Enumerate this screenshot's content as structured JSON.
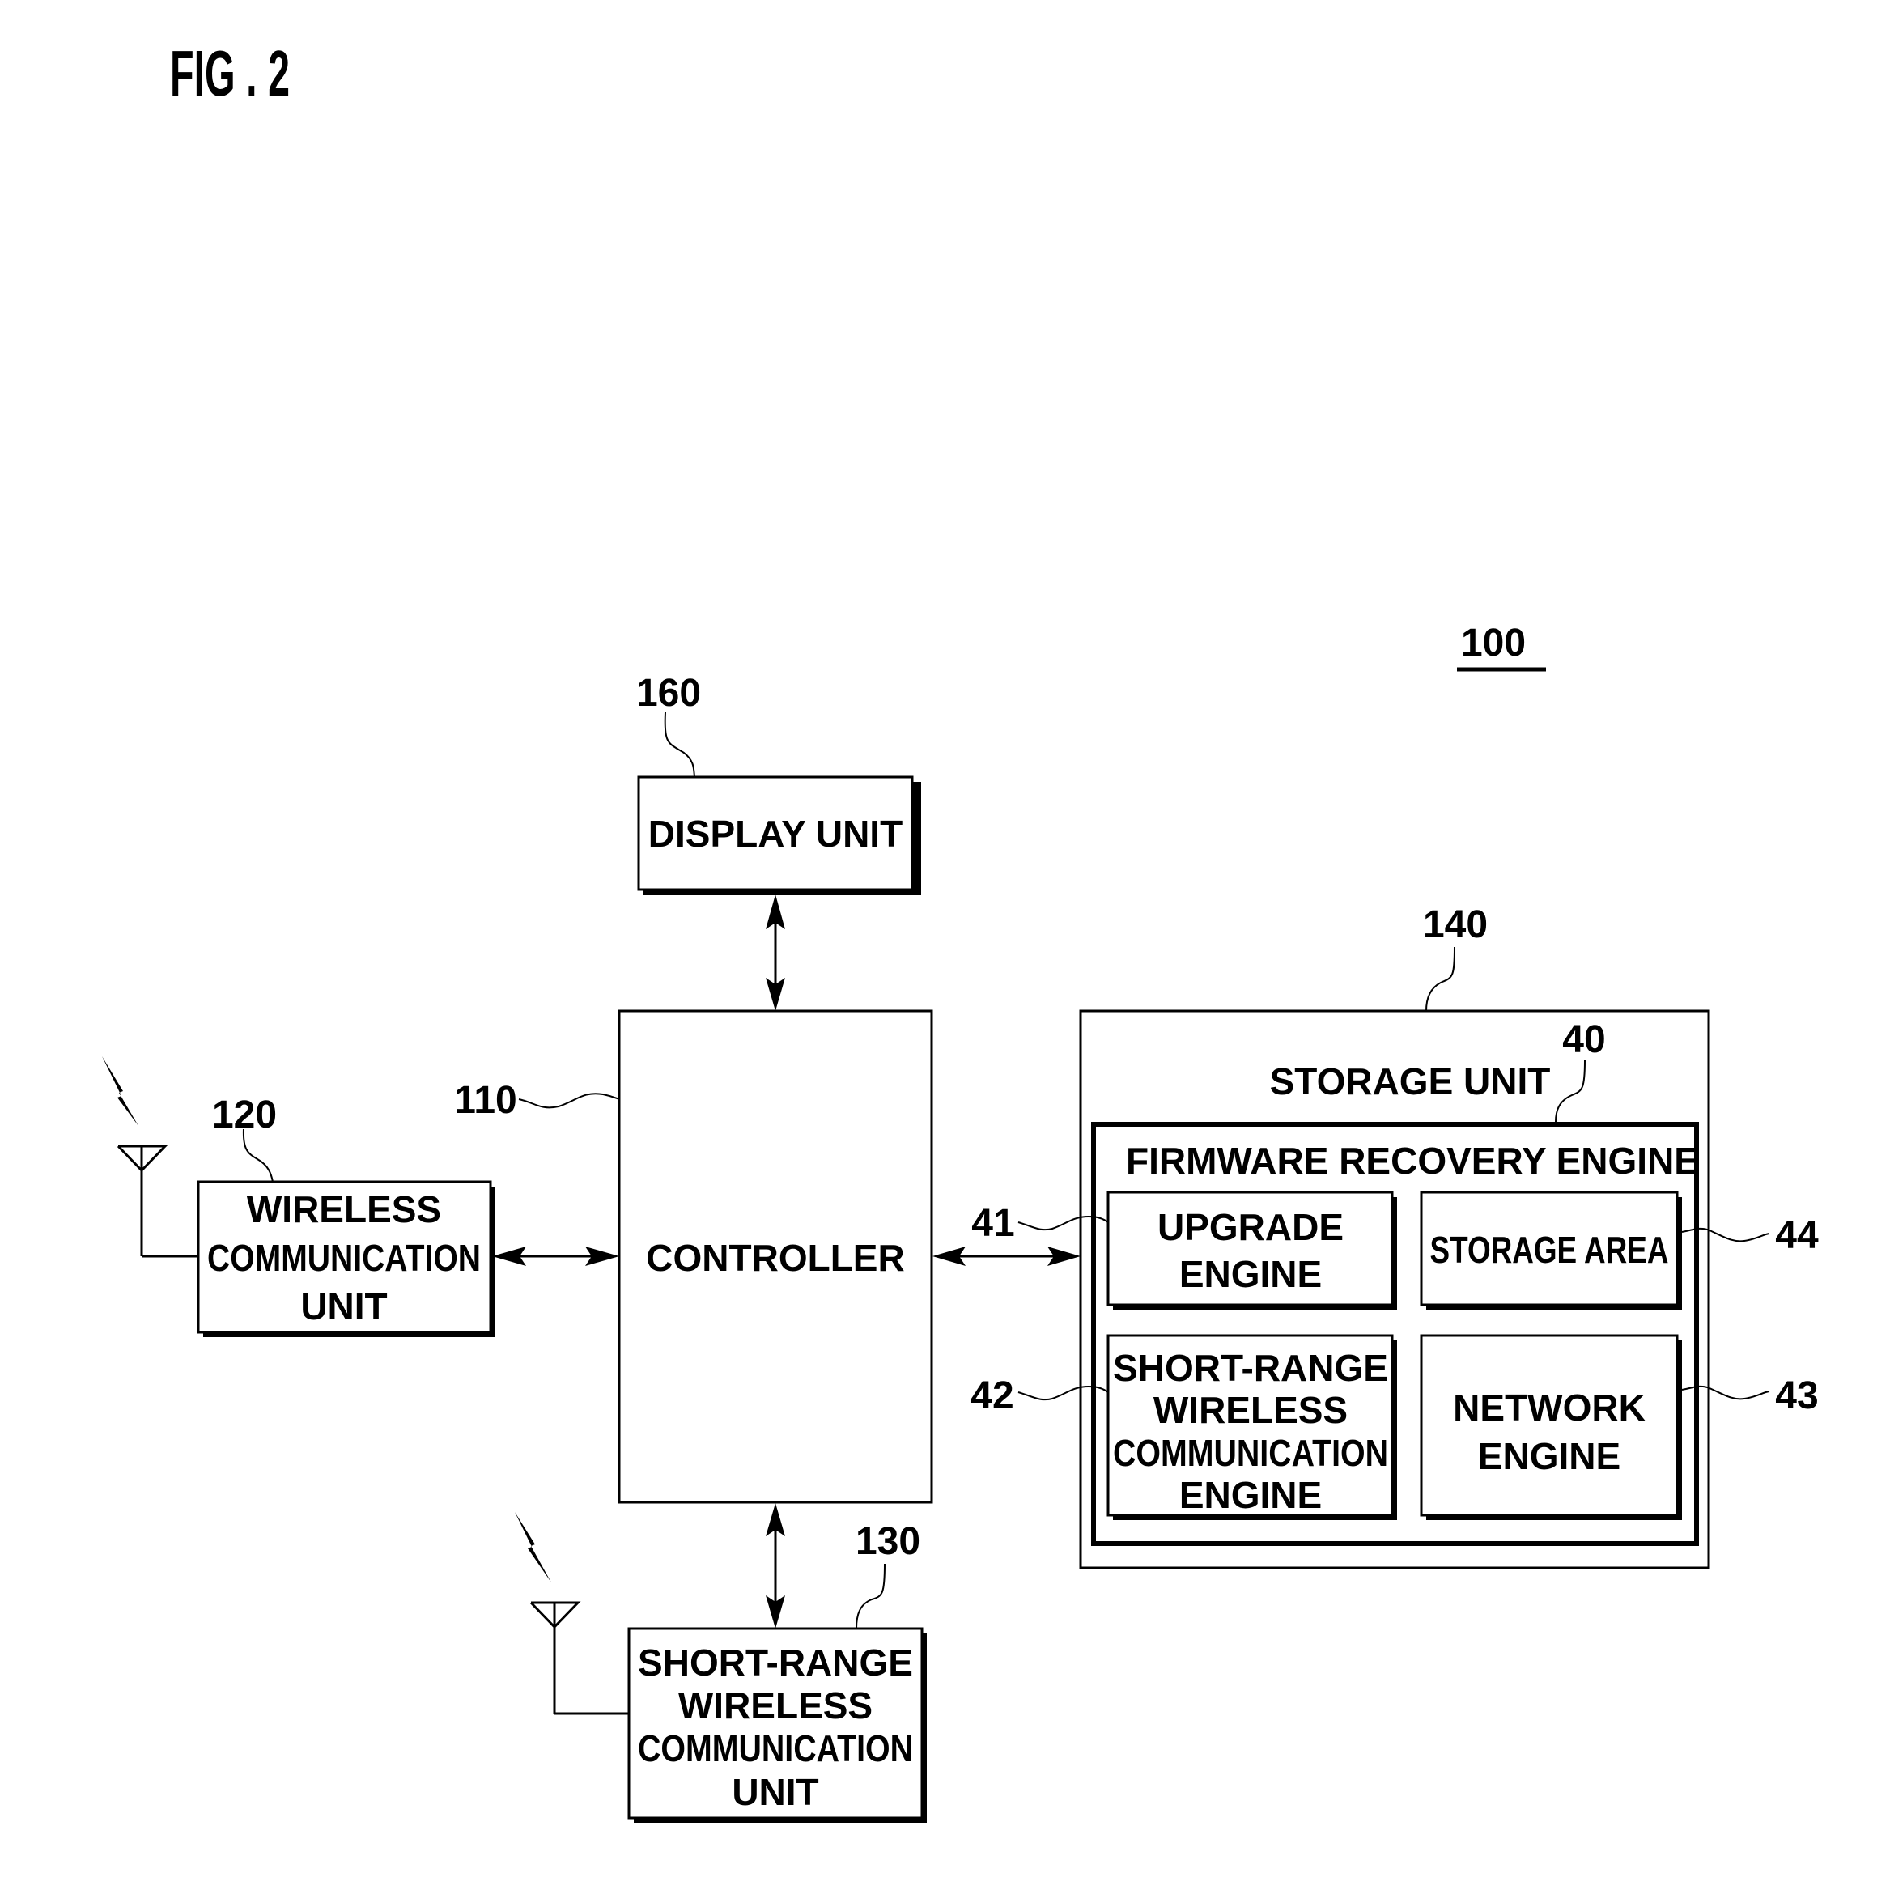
{
  "figure": {
    "title": "FIG . 2",
    "device_ref": "100"
  },
  "blocks": {
    "display_unit": {
      "ref": "160",
      "lines": [
        "DISPLAY UNIT"
      ]
    },
    "controller": {
      "ref": "110",
      "lines": [
        "CONTROLLER"
      ]
    },
    "wireless_unit": {
      "ref": "120",
      "lines": [
        "WIRELESS",
        "COMMUNICATION",
        "UNIT"
      ]
    },
    "short_range_unit": {
      "ref": "130",
      "lines": [
        "SHORT-RANGE",
        "WIRELESS",
        "COMMUNICATION",
        "UNIT"
      ]
    },
    "storage_unit": {
      "ref": "140",
      "lines": [
        "STORAGE UNIT"
      ]
    },
    "firmware_engine": {
      "ref": "40",
      "lines": [
        "FIRMWARE RECOVERY ENGINE"
      ]
    },
    "upgrade_engine": {
      "ref": "41",
      "lines": [
        "UPGRADE",
        "ENGINE"
      ]
    },
    "short_range_engine": {
      "ref": "42",
      "lines": [
        "SHORT-RANGE",
        "WIRELESS",
        "COMMUNICATION",
        "ENGINE"
      ]
    },
    "network_engine": {
      "ref": "43",
      "lines": [
        "NETWORK",
        "ENGINE"
      ]
    },
    "storage_area": {
      "ref": "44",
      "lines": [
        "STORAGE AREA"
      ]
    }
  },
  "icons": {
    "antenna": "antenna-icon",
    "signal": "lightning-signal-icon"
  }
}
